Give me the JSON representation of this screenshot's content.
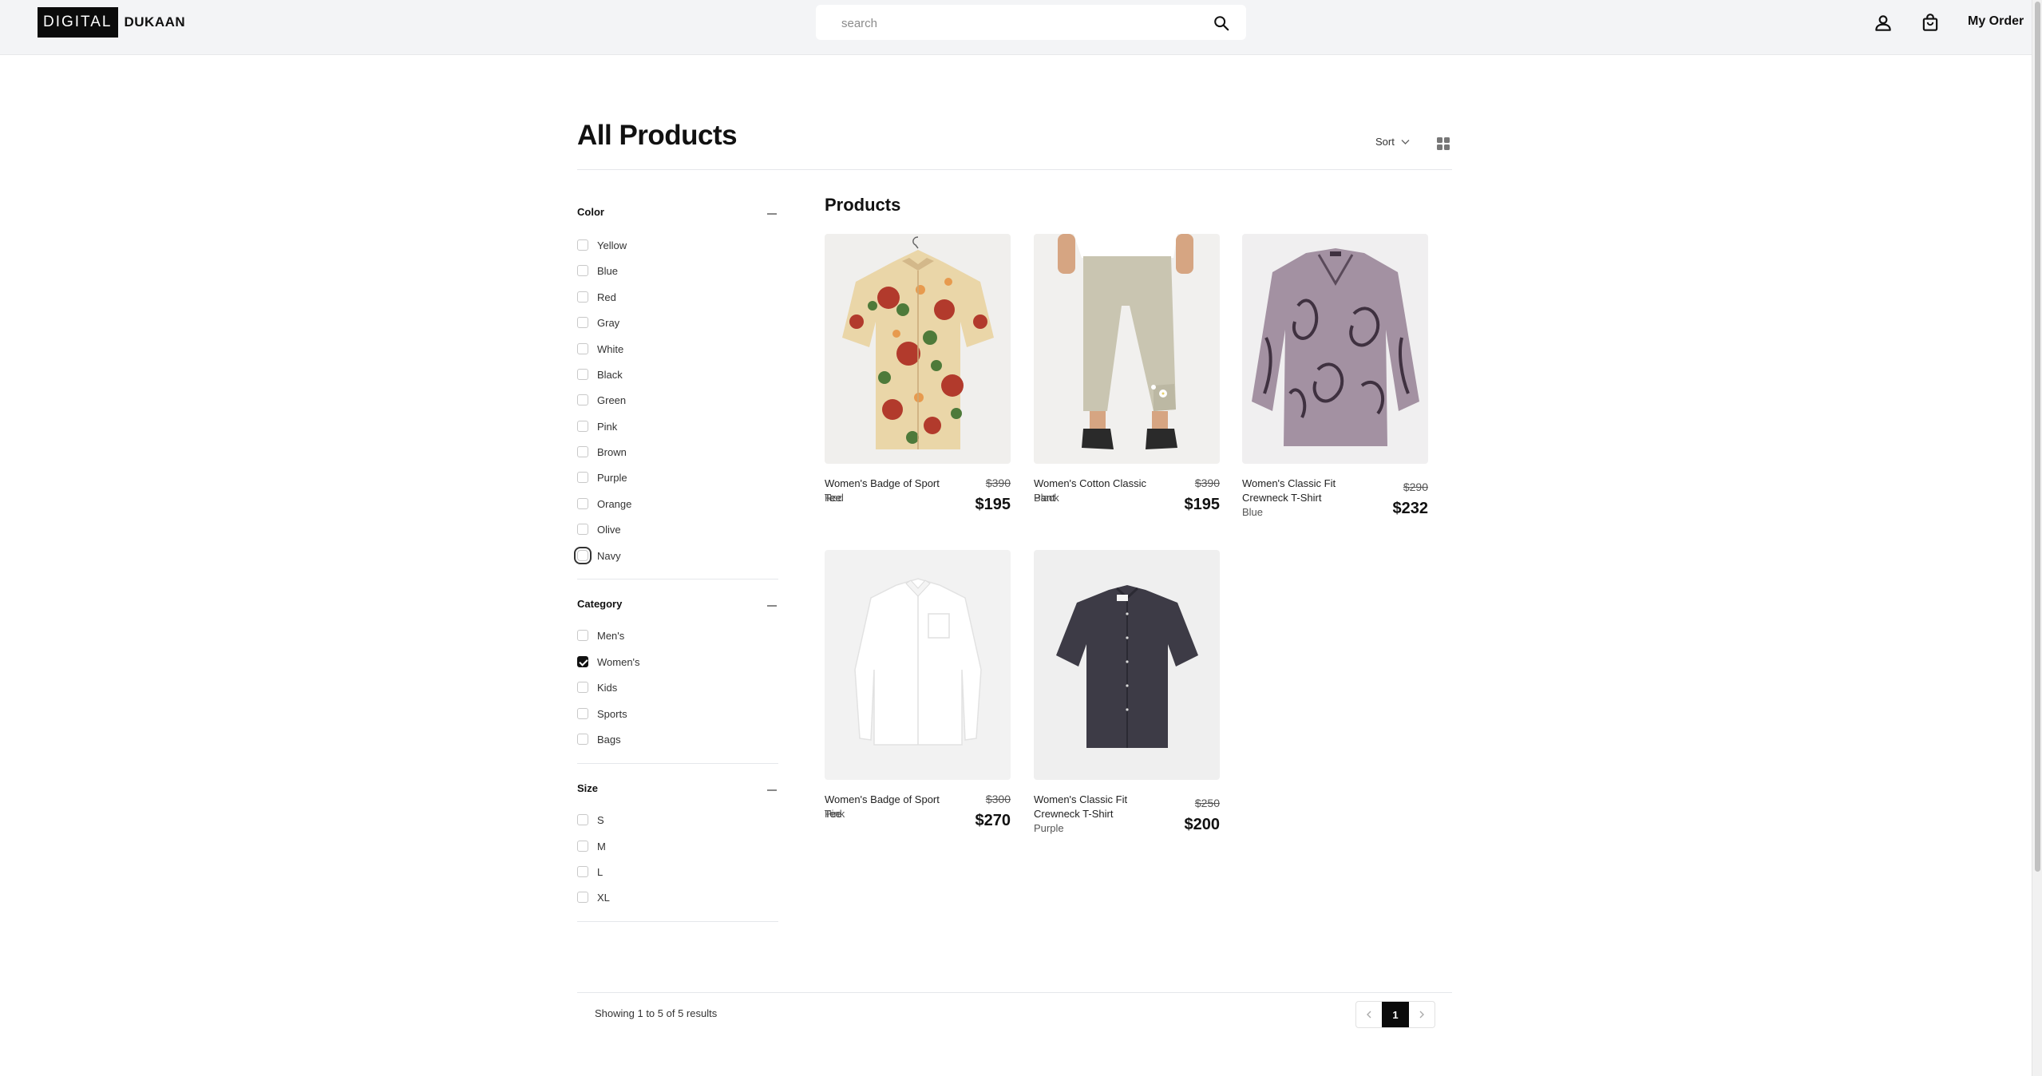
{
  "brand": {
    "logo_left": "DIGITAL",
    "logo_right": "DUKAAN"
  },
  "search": {
    "placeholder": "search",
    "value": ""
  },
  "header": {
    "my_order": "My Order"
  },
  "page": {
    "title": "All Products",
    "sort_label": "Sort"
  },
  "filters": {
    "color": {
      "title": "Color",
      "options": [
        {
          "label": "Yellow",
          "checked": false
        },
        {
          "label": "Blue",
          "checked": false
        },
        {
          "label": "Red",
          "checked": false
        },
        {
          "label": "Gray",
          "checked": false
        },
        {
          "label": "White",
          "checked": false
        },
        {
          "label": "Black",
          "checked": false
        },
        {
          "label": "Green",
          "checked": false
        },
        {
          "label": "Pink",
          "checked": false
        },
        {
          "label": "Brown",
          "checked": false
        },
        {
          "label": "Purple",
          "checked": false
        },
        {
          "label": "Orange",
          "checked": false
        },
        {
          "label": "Olive",
          "checked": false
        },
        {
          "label": "Navy",
          "checked": false,
          "focused": true
        }
      ]
    },
    "category": {
      "title": "Category",
      "options": [
        {
          "label": "Men's",
          "checked": false
        },
        {
          "label": "Women's",
          "checked": true
        },
        {
          "label": "Kids",
          "checked": false
        },
        {
          "label": "Sports",
          "checked": false
        },
        {
          "label": "Bags",
          "checked": false
        }
      ]
    },
    "size": {
      "title": "Size",
      "options": [
        {
          "label": "S",
          "checked": false
        },
        {
          "label": "M",
          "checked": false
        },
        {
          "label": "L",
          "checked": false
        },
        {
          "label": "XL",
          "checked": false
        }
      ]
    }
  },
  "products": {
    "heading": "Products",
    "items": [
      {
        "name": "Women's Badge of Sport Tee",
        "color": "Red",
        "old_price": "$390",
        "price": "$195",
        "image": "floral-shirt"
      },
      {
        "name": "Women's Cotton Classic Pant",
        "color": "Black",
        "old_price": "$390",
        "price": "$195",
        "image": "linen-pants"
      },
      {
        "name": "Women's Classic Fit Crewneck T-Shirt",
        "color": "Blue",
        "old_price": "$290",
        "price": "$232",
        "image": "paisley-blouse"
      },
      {
        "name": "Women's Badge of Sport Tee",
        "color": "Pink",
        "old_price": "$300",
        "price": "$270",
        "image": "white-shirt"
      },
      {
        "name": "Women's Classic Fit Crewneck T-Shirt",
        "color": "Purple",
        "old_price": "$250",
        "price": "$200",
        "image": "dark-shirt"
      }
    ]
  },
  "pagination": {
    "results_text": "Showing 1 to 5 of 5 results",
    "prev_icon": "chevron-left-icon",
    "current_page": "1",
    "next_icon": "chevron-right-icon"
  },
  "icons": {
    "search": "search-icon",
    "user": "user-icon",
    "bag": "shopping-bag-icon",
    "grid": "grid-view-icon",
    "sort": "chevron-down-icon"
  },
  "colors": {
    "header_bg": "#f3f4f6",
    "accent": "#0b0b0b",
    "card_bg": "#f1f1f1"
  }
}
